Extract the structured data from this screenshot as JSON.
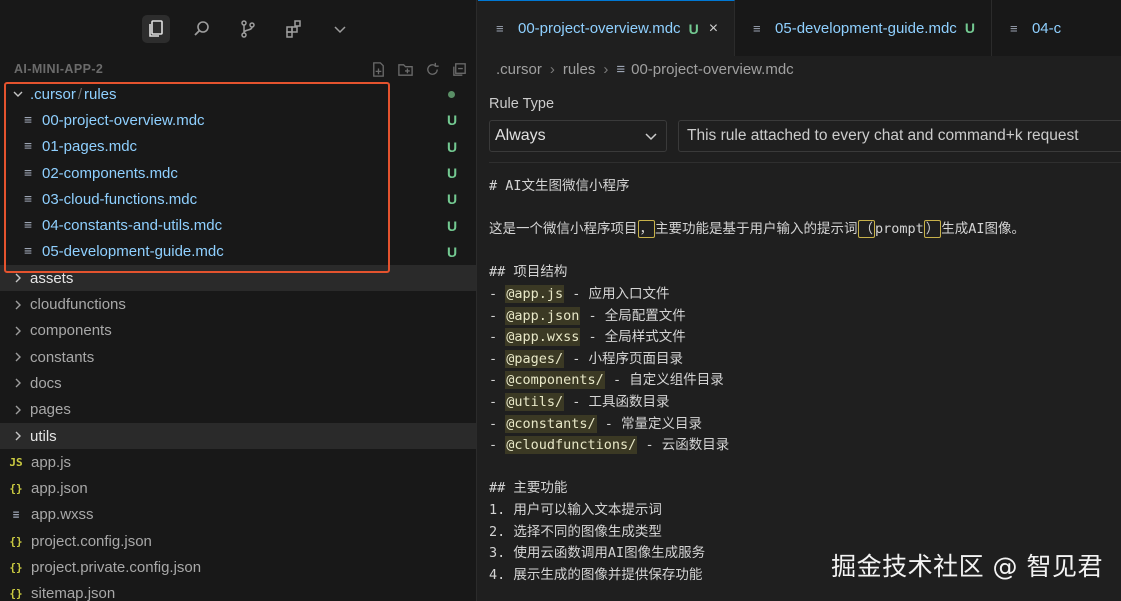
{
  "activity": {
    "icons": [
      "explorer-icon",
      "search-icon",
      "source-control-icon",
      "extensions-icon",
      "chevron-down-icon"
    ]
  },
  "explorer": {
    "title": "AI-MINI-APP-2",
    "actions": [
      "new-file-icon",
      "new-folder-icon",
      "refresh-icon",
      "collapse-all-icon"
    ],
    "tree": [
      {
        "label_a": ".cursor",
        "label_b": "rules",
        "type": "folder-open",
        "status": "dot"
      },
      {
        "label": "00-project-overview.mdc",
        "type": "child",
        "status": "U"
      },
      {
        "label": "01-pages.mdc",
        "type": "child",
        "status": "U"
      },
      {
        "label": "02-components.mdc",
        "type": "child",
        "status": "U"
      },
      {
        "label": "03-cloud-functions.mdc",
        "type": "child",
        "status": "U"
      },
      {
        "label": "04-constants-and-utils.mdc",
        "type": "child",
        "status": "U"
      },
      {
        "label": "05-development-guide.mdc",
        "type": "child",
        "status": "U"
      },
      {
        "label": "assets",
        "type": "folder"
      },
      {
        "label": "cloudfunctions",
        "type": "folder"
      },
      {
        "label": "components",
        "type": "folder"
      },
      {
        "label": "constants",
        "type": "folder"
      },
      {
        "label": "docs",
        "type": "folder"
      },
      {
        "label": "pages",
        "type": "folder"
      },
      {
        "label": "utils",
        "type": "folder"
      },
      {
        "label": "app.js",
        "type": "file",
        "icon": "JS"
      },
      {
        "label": "app.json",
        "type": "file",
        "icon": "{}"
      },
      {
        "label": "app.wxss",
        "type": "file",
        "icon": "≡"
      },
      {
        "label": "project.config.json",
        "type": "file",
        "icon": "{}"
      },
      {
        "label": "project.private.config.json",
        "type": "file",
        "icon": "{}"
      },
      {
        "label": "sitemap.json",
        "type": "file",
        "icon": "{}"
      }
    ]
  },
  "tabs": [
    {
      "label": "00-project-overview.mdc",
      "status": "U",
      "close": "×"
    },
    {
      "label": "05-development-guide.mdc",
      "status": "U"
    },
    {
      "label": "04-c"
    }
  ],
  "breadcrumb": {
    "items": [
      ".cursor",
      "rules",
      "00-project-overview.mdc"
    ],
    "sep": "›"
  },
  "rule": {
    "type_label": "Rule Type",
    "type_value": "Always",
    "description": "This rule attached to every chat and command+k request"
  },
  "code": {
    "h1": "# AI文生图微信小程序",
    "intro_a": "这是一个微信小程序项目",
    "intro_comma": "，",
    "intro_b": "主要功能是基于用户输入的提示词",
    "intro_lp": "（",
    "intro_prompt": "prompt",
    "intro_rp": "）",
    "intro_c": "生成AI图像。",
    "h2_structure": "## 项目结构",
    "structure": [
      {
        "tok": "@app.js",
        "desc": " - 应用入口文件"
      },
      {
        "tok": "@app.json",
        "desc": " - 全局配置文件"
      },
      {
        "tok": "@app.wxss",
        "desc": " - 全局样式文件"
      },
      {
        "tok": "@pages/",
        "desc": " - 小程序页面目录"
      },
      {
        "tok": "@components/",
        "desc": " - 自定义组件目录"
      },
      {
        "tok": "@utils/",
        "desc": " - 工具函数目录"
      },
      {
        "tok": "@constants/",
        "desc": " - 常量定义目录"
      },
      {
        "tok": "@cloudfunctions/",
        "desc": " - 云函数目录"
      }
    ],
    "h2_features": "## 主要功能",
    "features": [
      "1. 用户可以输入文本提示词",
      "2. 选择不同的图像生成类型",
      "3. 使用云函数调用AI图像生成服务",
      "4. 展示生成的图像并提供保存功能"
    ]
  },
  "watermark": "掘金技术社区 @ 智见君"
}
